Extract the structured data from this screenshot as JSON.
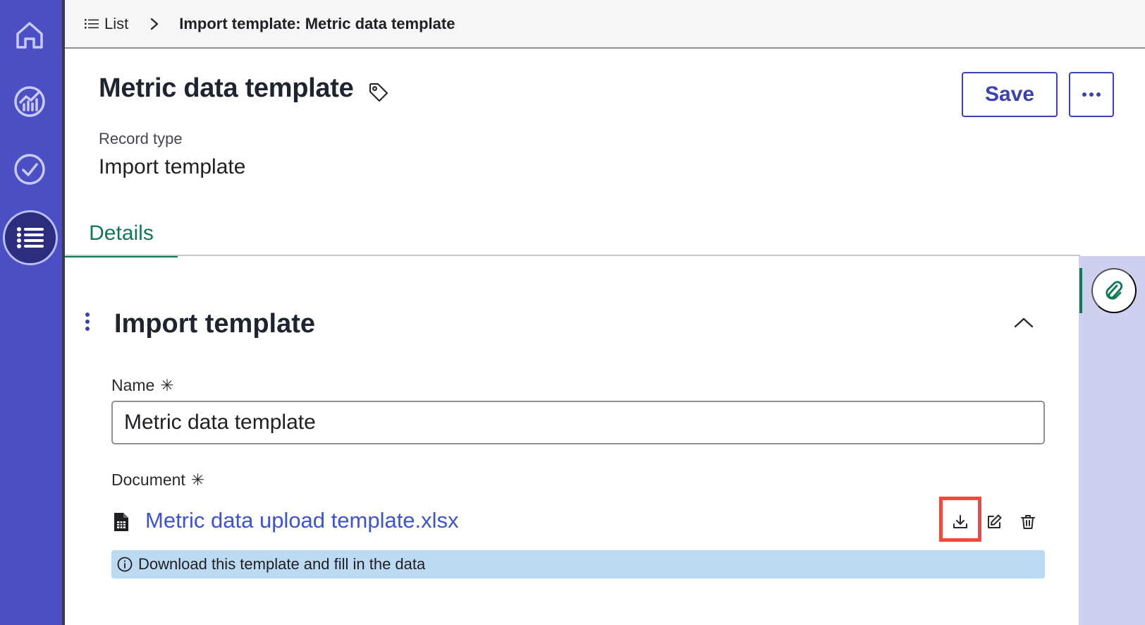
{
  "nav": {
    "items": [
      {
        "name": "home",
        "icon": "home-icon"
      },
      {
        "name": "dashboards",
        "icon": "chart-circle-icon"
      },
      {
        "name": "tasks",
        "icon": "check-circle-icon"
      },
      {
        "name": "list",
        "icon": "list-icon",
        "active": true
      }
    ],
    "colors": {
      "rail": "#4a4fc4",
      "active": "#2b2e7f"
    }
  },
  "breadcrumb": {
    "list_label": "List",
    "current": "Import template: Metric data template"
  },
  "header": {
    "title": "Metric data template",
    "save_label": "Save",
    "more_label": "···",
    "record_type_label": "Record type",
    "record_type_value": "Import template"
  },
  "tabs": [
    {
      "label": "Details",
      "active": true
    }
  ],
  "section": {
    "title": "Import template",
    "name_label": "Name",
    "name_value": "Metric data template",
    "required_mark": "✳",
    "document_label": "Document",
    "file_name": "Metric data upload template.xlsx",
    "info_text": "Download this template and fill in the data"
  },
  "colors": {
    "accent": "#3b40b5",
    "tab_active": "#0e7a52",
    "link": "#3c52d9",
    "info_bg": "#bcdaf2",
    "highlight": "#f04a3e"
  }
}
